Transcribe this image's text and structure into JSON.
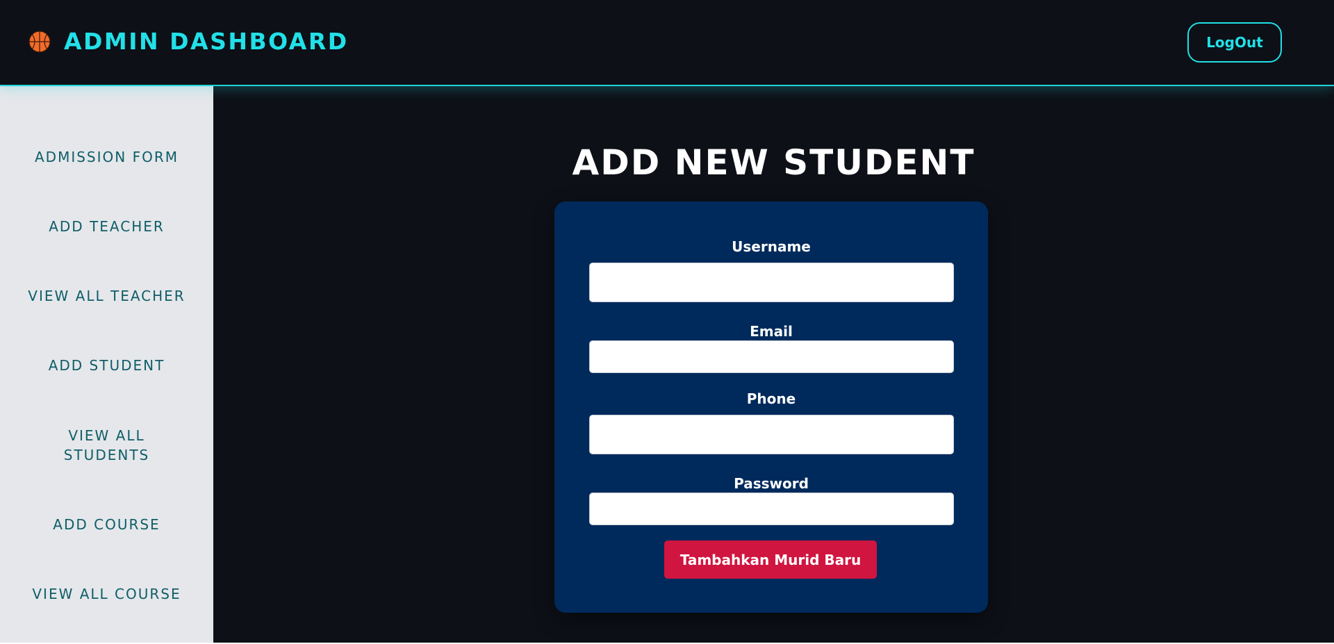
{
  "header": {
    "title": "ADMIN DASHBOARD",
    "logo_icon": "basketball-icon",
    "logout_label": "LogOut",
    "accent_color": "#22e0e8"
  },
  "sidebar": {
    "items": [
      {
        "label": "ADMISSION FORM"
      },
      {
        "label": "ADD TEACHER"
      },
      {
        "label": "VIEW ALL TEACHER"
      },
      {
        "label": "ADD STUDENT"
      },
      {
        "label": "VIEW ALL STUDENTS"
      },
      {
        "label": "ADD COURSE"
      },
      {
        "label": "VIEW ALL COURSE"
      }
    ]
  },
  "main": {
    "title": "ADD NEW STUDENT",
    "form": {
      "fields": [
        {
          "label": "Username",
          "value": "",
          "placeholder": ""
        },
        {
          "label": "Email",
          "value": "",
          "placeholder": ""
        },
        {
          "label": "Phone",
          "value": "",
          "placeholder": ""
        },
        {
          "label": "Password",
          "value": "",
          "placeholder": ""
        }
      ],
      "submit_label": "Tambahkan Murid Baru",
      "submit_color": "#d01540",
      "card_color": "#002a5c"
    }
  }
}
